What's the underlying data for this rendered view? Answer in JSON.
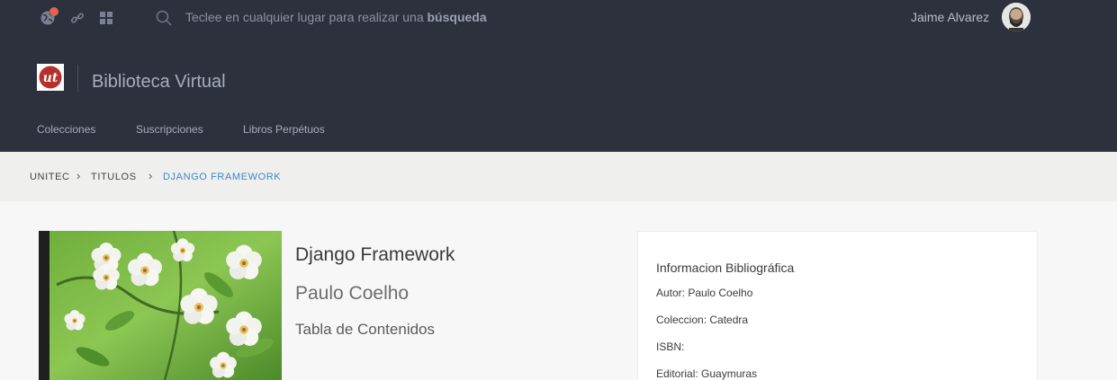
{
  "topbar": {
    "icons": [
      "globe-icon",
      "link-icon",
      "grid-icon"
    ],
    "notification_color": "#e1634f",
    "search": {
      "placeholder_prefix": "Teclee en cualquier lugar para realizar una ",
      "placeholder_bold": "búsqueda"
    },
    "user": {
      "name": "Jaime Alvarez"
    }
  },
  "header": {
    "logo_text": "ut",
    "app_title": "Biblioteca Virtual",
    "nav": [
      {
        "label": "Colecciones"
      },
      {
        "label": "Suscripciones"
      },
      {
        "label": "Libros Perpétuos"
      }
    ]
  },
  "breadcrumb": {
    "items": [
      {
        "label": "UNITEC"
      },
      {
        "label": "TITULOS"
      },
      {
        "label": "DJANGO FRAMEWORK"
      }
    ]
  },
  "book": {
    "title": "Django Framework",
    "author": "Paulo Coelho",
    "toc_label": "Tabla de Contenidos"
  },
  "info": {
    "heading": "Informacion Bibliográfica",
    "rows": [
      {
        "text": "Autor: Paulo Coelho"
      },
      {
        "text": "Coleccion: Catedra"
      },
      {
        "text": "ISBN:"
      },
      {
        "text": "Editorial: Guaymuras"
      }
    ]
  },
  "colors": {
    "topbar_bg": "#2d313d",
    "breadcrumb_bg": "#efefed",
    "accent": "#3d87c9",
    "logo_red": "#b5322c"
  }
}
